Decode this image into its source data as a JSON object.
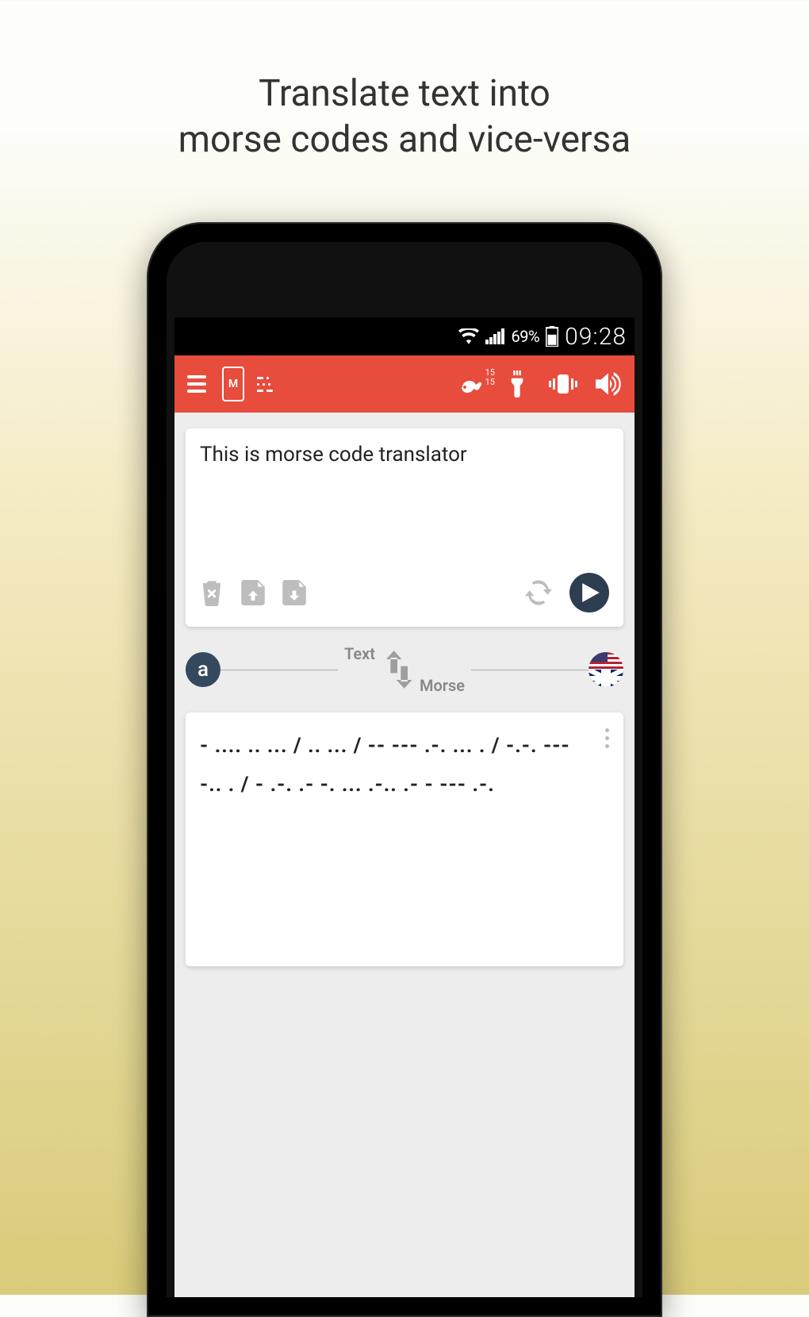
{
  "promo": {
    "line1": "Translate text into",
    "line2": "morse codes and vice-versa"
  },
  "status": {
    "battery_pct": "69%",
    "time": "09:28"
  },
  "appbar": {
    "logo_letter": "M",
    "speed_top": "15",
    "speed_bottom": "15"
  },
  "input_card": {
    "text": "This is morse code translator"
  },
  "swap": {
    "left_badge": "a",
    "label_text": "Text",
    "label_morse": "Morse"
  },
  "output_card": {
    "morse": "- .... .. ... / .. ... / -- --- .-. ... . / -.-. --- -.. . / - .-. .- -. ... .-.. .- - --- .-."
  }
}
